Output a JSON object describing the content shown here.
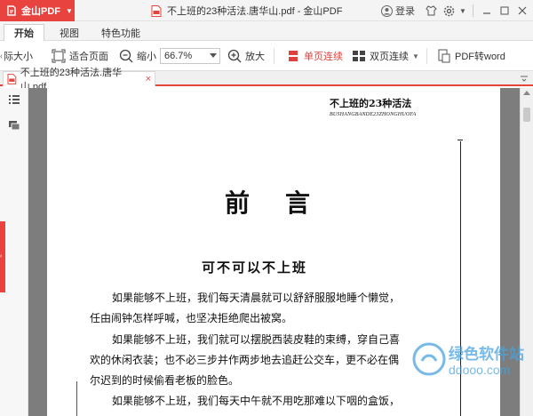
{
  "titlebar": {
    "brand": "金山PDF",
    "title": "不上班的23种活法.唐华山.pdf - 金山PDF",
    "login": "登录"
  },
  "menu": {
    "tabs": [
      "开始",
      "视图",
      "特色功能"
    ]
  },
  "toolbar": {
    "actual_size": "际大小",
    "fit_page": "适合页面",
    "zoom_out": "缩小",
    "zoom_value": "66.7%",
    "zoom_in": "放大",
    "single_page": "单页连续",
    "double_page": "双页连续",
    "pdf_to_word": "PDF转word"
  },
  "doctab": {
    "filename": "不上班的23种活法.唐华山.pdf"
  },
  "page": {
    "header_title": "不上班的23种活法",
    "header_pinyin": "BUSHANGBANDE23ZHONGHUOFA",
    "heading": "前言",
    "subheading": "可不可以不上班",
    "lines": [
      "如果能够不上班，我们每天清晨就可以舒舒服服地睡个懒觉，",
      "任由闹钟怎样呼喊，也坚决拒绝爬出被窝。",
      "如果能够不上班，我们就可以摆脱西装皮鞋的束缚，穿自己喜",
      "欢的休闲衣装；也不必三步并作两步地去追赶公交车，更不必在偶",
      "尔迟到的时候偷看老板的脸色。",
      "如果能够不上班，我们每天中午就不用吃那难以下咽的盒饭，"
    ]
  },
  "watermark": {
    "text": "绿色软件站",
    "url": "ddooo.com"
  },
  "colors": {
    "brand_red": "#e8433e",
    "viewer_gray": "#7d7d7d"
  }
}
